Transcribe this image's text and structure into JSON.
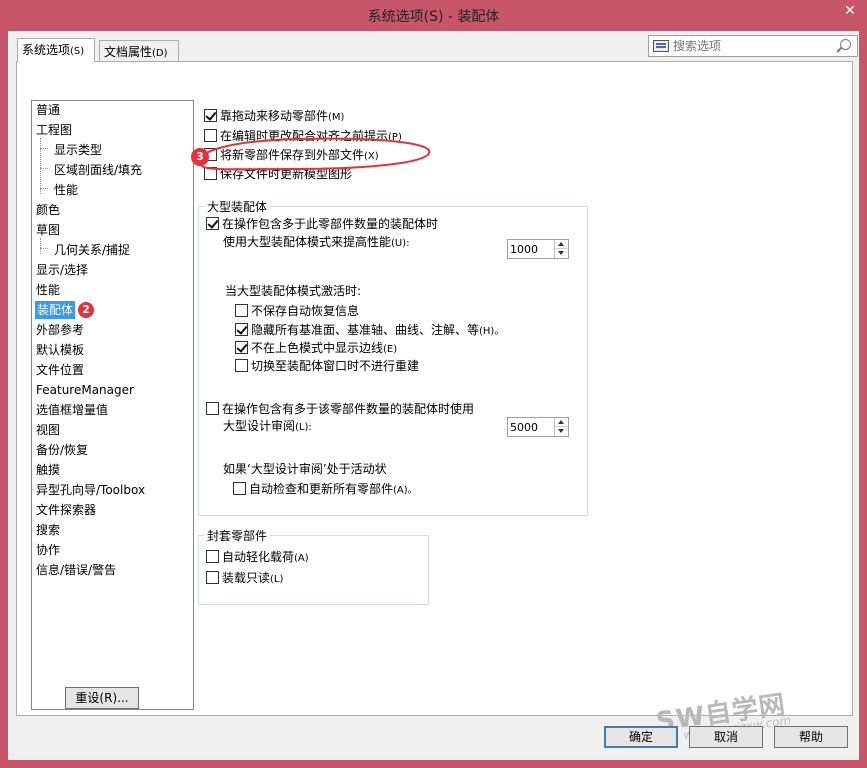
{
  "window": {
    "title": "系统选项(S) - 装配体",
    "close_glyph": "✕"
  },
  "tabs": [
    {
      "label": "系统选项",
      "hotkey": "(S)"
    },
    {
      "label": "文档属性",
      "hotkey": "(D)"
    }
  ],
  "search": {
    "placeholder": "搜索选项"
  },
  "tree": {
    "items": [
      "普通",
      "工程图",
      "显示类型",
      "区域剖面线/填充",
      "性能",
      "颜色",
      "草图",
      "几何关系/捕捉",
      "显示/选择",
      "性能",
      "装配体",
      "外部参考",
      "默认模板",
      "文件位置",
      "FeatureManager",
      "选值框增量值",
      "视图",
      "备份/恢复",
      "触摸",
      "异型孔向导/Toolbox",
      "文件探索器",
      "搜索",
      "协作",
      "信息/错误/警告"
    ],
    "badge_selected": "2",
    "reset_label": "重设(R)..."
  },
  "options": {
    "top": [
      {
        "label": "靠拖动来移动零部件",
        "hotkey": "(M)",
        "checked": true
      },
      {
        "label": "在编辑时更改配合对齐之前提示",
        "hotkey": "(P)",
        "checked": false
      },
      {
        "label": "将新零部件保存到外部文件",
        "hotkey": "(X)",
        "checked": false
      },
      {
        "label": "保存文件时更新模型图形",
        "hotkey": "",
        "checked": false
      }
    ],
    "annotation_badge": "3",
    "large_assembly": {
      "legend": "大型装配体",
      "enable_line1": "在操作包含多于此零部件数量的装配体时",
      "enable_line2": "使用大型装配体模式来提高性能",
      "enable_hotkey": "(U):",
      "enable_checked": true,
      "threshold": "1000",
      "when_active": "当大型装配体模式激活时:",
      "sub": [
        {
          "label": "不保存自动恢复信息",
          "hotkey": "",
          "checked": false
        },
        {
          "label": "隐藏所有基准面、基准轴、曲线、注解、等",
          "hotkey": "(H)。",
          "checked": true
        },
        {
          "label": "不在上色模式中显示边线",
          "hotkey": "(E)",
          "checked": true
        },
        {
          "label": "切换至装配体窗口时不进行重建",
          "hotkey": "",
          "checked": false
        }
      ],
      "review_line1": "在操作包含有多于该零部件数量的装配体时使用",
      "review_line2": "大型设计审阅",
      "review_hotkey": "(L):",
      "review_checked": false,
      "review_threshold": "5000",
      "review_active": "如果‘大型设计审阅’处于活动状",
      "review_sub": {
        "label": "自动检查和更新所有零部件",
        "hotkey": "(A)。",
        "checked": false
      }
    },
    "envelope": {
      "legend": "封套零部件",
      "items": [
        {
          "label": "自动轻化载荷",
          "hotkey": "(A)",
          "checked": false
        },
        {
          "label": "装载只读",
          "hotkey": "(L)",
          "checked": false
        }
      ]
    }
  },
  "buttons": {
    "ok": "确定",
    "cancel": "取消",
    "help": "帮助"
  },
  "watermark": {
    "brand": "SW自学网",
    "url": "www.swrjzxw.com"
  },
  "colors": {
    "titlebar": "#c8566a",
    "selection": "#3399ff",
    "badge": "#e8303a",
    "annotation": "#e8303a"
  }
}
